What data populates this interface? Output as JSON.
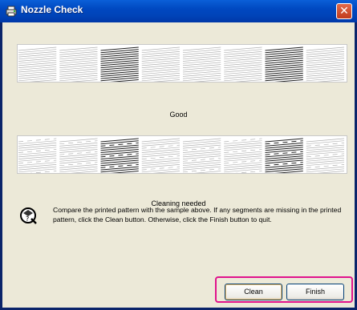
{
  "window": {
    "title": "Nozzle Check",
    "close_glyph": "✕"
  },
  "samples": [
    {
      "caption": "Good",
      "state": "good"
    },
    {
      "caption": "Cleaning needed",
      "state": "missing-segments"
    }
  ],
  "message": "Compare the printed pattern with the sample above. If any segments are missing in the printed pattern, click the Clean button. Otherwise, click the Finish button to quit.",
  "buttons": {
    "clean": "Clean",
    "finish": "Finish"
  },
  "colors": {
    "titlebar": "#0054e3",
    "highlight": "#e0138c"
  }
}
